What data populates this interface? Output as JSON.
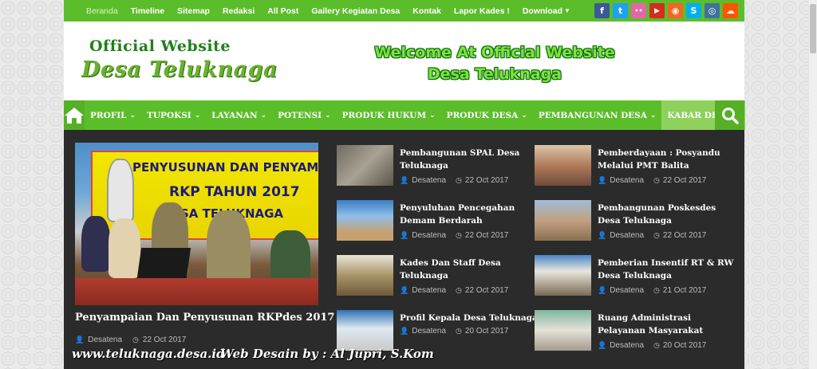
{
  "topnav": [
    {
      "label": "Beranda",
      "active": true
    },
    {
      "label": "Timeline"
    },
    {
      "label": "Sitemap"
    },
    {
      "label": "Redaksi"
    },
    {
      "label": "All Post"
    },
    {
      "label": "Gallery Kegiatan Desa"
    },
    {
      "label": "Kontak"
    },
    {
      "label": "Lapor Kades !"
    },
    {
      "label": "Download",
      "dropdown": true
    }
  ],
  "socials": [
    {
      "name": "facebook-icon",
      "glyph": "f",
      "color": "#3b5998"
    },
    {
      "name": "twitter-icon",
      "glyph": "t",
      "color": "#1da1f2"
    },
    {
      "name": "flickr-icon",
      "glyph": "••",
      "color": "#e466a6"
    },
    {
      "name": "youtube-icon",
      "glyph": "▶",
      "color": "#d42c1f"
    },
    {
      "name": "rss-icon",
      "glyph": "◉",
      "color": "#f26522"
    },
    {
      "name": "skype-icon",
      "glyph": "S",
      "color": "#00aff0"
    },
    {
      "name": "instagram-icon",
      "glyph": "◎",
      "color": "#3f729b"
    },
    {
      "name": "soundcloud-icon",
      "glyph": "☁",
      "color": "#ff5500"
    }
  ],
  "header": {
    "logo_top": "Official Website",
    "logo_main": "Desa Teluknaga",
    "welcome_line1": "Welcome At Official Website",
    "welcome_line2": "Desa Teluknaga"
  },
  "mainnav": [
    {
      "label": "PROFIL"
    },
    {
      "label": "TUPOKSI"
    },
    {
      "label": "LAYANAN"
    },
    {
      "label": "POTENSI"
    },
    {
      "label": "PRODUK HUKUM"
    },
    {
      "label": "PRODUK DESA"
    },
    {
      "label": "PEMBANGUNAN DESA"
    },
    {
      "label": "KABAR DESA",
      "active": true
    }
  ],
  "featured": {
    "banner_line1": "PENYUSUNAN DAN PENYAMPA",
    "banner_line2": "RKP TAHUN 2017",
    "banner_line3": "SA TELUKNAGA",
    "title": "Penyampaian Dan Penyusunan RKPdes 2017",
    "author": "Desatena",
    "date": "22 Oct 2017"
  },
  "posts_col1": [
    {
      "title": "Pembangunan SPAL Desa Teluknaga",
      "author": "Desatena",
      "date": "22 Oct 2017"
    },
    {
      "title": "Penyuluhan Pencegahan Demam Berdarah",
      "author": "Desatena",
      "date": "22 Oct 2017"
    },
    {
      "title": "Kades Dan Staff Desa Teluknaga",
      "author": "Desatena",
      "date": "22 Oct 2017"
    },
    {
      "title": "Profil Kepala Desa Teluknaga",
      "author": "Desatena",
      "date": "20 Oct 2017"
    }
  ],
  "posts_col2": [
    {
      "title": "Pemberdayaan : Posyandu Melalui PMT Balita",
      "author": "Desatena",
      "date": "22 Oct 2017"
    },
    {
      "title": "Pembangunan Poskesdes Desa Teluknaga",
      "author": "Desatena",
      "date": "22 Oct 2017"
    },
    {
      "title": "Pemberian Insentif RT & RW Desa Teluknaga",
      "author": "Desatena",
      "date": "21 Oct 2017"
    },
    {
      "title": "Ruang Administrasi Pelayanan Masyarakat",
      "author": "Desatena",
      "date": "20 Oct 2017"
    }
  ],
  "footer": {
    "site": "www.teluknaga.desa.id",
    "credit": "Web Desain by : Al Jupri, S.Kom"
  },
  "colors": {
    "brand_green": "#5cbd2b",
    "content_bg": "#2b2b2b"
  }
}
